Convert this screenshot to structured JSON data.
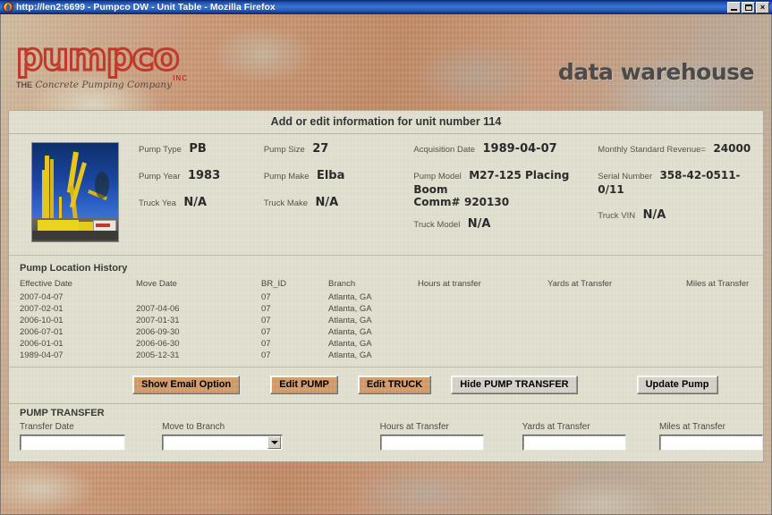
{
  "window": {
    "title": "http://len2:6699 - Pumpco DW - Unit Table - Mozilla Firefox",
    "minimize_label": "",
    "maximize_label": "",
    "close_label": "×"
  },
  "banner": {
    "logo_word": "pumpco",
    "logo_inc": "INC",
    "logo_tagline_bold": "THE",
    "logo_tagline": "Concrete Pumping Company",
    "right_title": "data warehouse"
  },
  "page_header": "Add or edit information for unit number 114",
  "unit_info": {
    "column1": [
      {
        "label": "Pump Type",
        "value": "PB"
      },
      {
        "label": "Pump Year",
        "value": "1983"
      },
      {
        "label": "Truck Yea",
        "value": "N/A"
      }
    ],
    "column2": [
      {
        "label": "Pump Size",
        "value": "27"
      },
      {
        "label": "Pump Make",
        "value": "Elba"
      },
      {
        "label": "Truck Make",
        "value": "N/A"
      }
    ],
    "column3": [
      {
        "label": "Acquisition Date",
        "value": "1989-04-07"
      },
      {
        "label": "Pump Model",
        "value": "M27-125 Placing Boom"
      },
      {
        "label": "Comm#",
        "value": "920130"
      },
      {
        "label": "Truck Model",
        "value": "N/A"
      }
    ],
    "column4": [
      {
        "label": "Monthly Standard Revenue=",
        "value": "24000"
      },
      {
        "label": "Serial Number",
        "value": "358-42-0511-0/11"
      },
      {
        "label": "Truck VIN",
        "value": "N/A"
      }
    ]
  },
  "history": {
    "title": "Pump Location History",
    "columns": [
      "Effective Date",
      "Move Date",
      "BR_ID",
      "Branch",
      "Hours at transfer",
      "Yards at Transfer",
      "Miles at Transfer"
    ],
    "rows": [
      [
        "2007-04-07",
        "",
        "07",
        "Atlanta, GA",
        "",
        "",
        ""
      ],
      [
        "2007-02-01",
        "2007-04-06",
        "07",
        "Atlanta, GA",
        "",
        "",
        ""
      ],
      [
        "2006-10-01",
        "2007-01-31",
        "07",
        "Atlanta, GA",
        "",
        "",
        ""
      ],
      [
        "2006-07-01",
        "2006-09-30",
        "07",
        "Atlanta, GA",
        "",
        "",
        ""
      ],
      [
        "2006-01-01",
        "2006-06-30",
        "07",
        "Atlanta, GA",
        "",
        "",
        ""
      ],
      [
        "1989-04-07",
        "2005-12-31",
        "07",
        "Atlanta, GA",
        "",
        "",
        ""
      ]
    ]
  },
  "buttons": {
    "show_email": "Show Email Option",
    "edit_pump": "Edit PUMP",
    "edit_truck": "Edit TRUCK",
    "hide_pump_transfer": "Hide PUMP TRANSFER",
    "update_pump": "Update Pump"
  },
  "transfer": {
    "title": "PUMP TRANSFER",
    "transfer_date": {
      "label": "Transfer Date",
      "value": "",
      "placeholder": ""
    },
    "move_to_branch": {
      "label": "Move to Branch",
      "value": "",
      "options": []
    },
    "hours_at_transfer": {
      "label": "Hours at Transfer",
      "value": "",
      "placeholder": ""
    },
    "yards_at_transfer": {
      "label": "Yards at Transfer",
      "value": "",
      "placeholder": ""
    },
    "miles_at_transfer": {
      "label": "Miles at Transfer",
      "value": "",
      "placeholder": ""
    }
  },
  "colors": {
    "panel_bg": "#e0dece",
    "button_tan": "#d39a6a",
    "button_gray": "#d4d0c8",
    "logo_red": "#c0392b",
    "titlebar_blue": "#0a246a"
  }
}
